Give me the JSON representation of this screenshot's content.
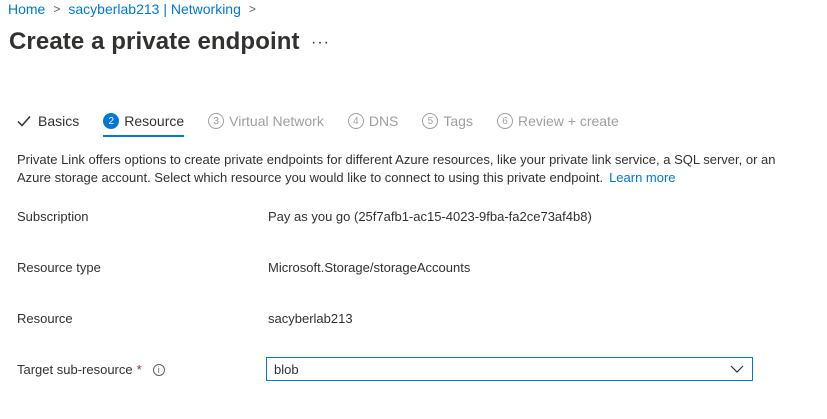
{
  "breadcrumb": {
    "items": [
      "Home",
      "sacyberlab213 | Networking"
    ]
  },
  "page": {
    "title": "Create a private endpoint",
    "more": "···"
  },
  "tabs": [
    {
      "number": "",
      "label": "Basics",
      "state": "done"
    },
    {
      "number": "2",
      "label": "Resource",
      "state": "active"
    },
    {
      "number": "3",
      "label": "Virtual Network",
      "state": "disabled"
    },
    {
      "number": "4",
      "label": "DNS",
      "state": "disabled"
    },
    {
      "number": "5",
      "label": "Tags",
      "state": "disabled"
    },
    {
      "number": "6",
      "label": "Review + create",
      "state": "disabled"
    }
  ],
  "description": {
    "text": "Private Link offers options to create private endpoints for different Azure resources, like your private link service, a SQL server, or an Azure storage account. Select which resource you would like to connect to using this private endpoint.",
    "link": "Learn more"
  },
  "fields": {
    "subscription": {
      "label": "Subscription",
      "value": "Pay as you go (25f7afb1-ac15-4023-9fba-fa2ce73af4b8)"
    },
    "resource_type": {
      "label": "Resource type",
      "value": "Microsoft.Storage/storageAccounts"
    },
    "resource": {
      "label": "Resource",
      "value": "sacyberlab213"
    },
    "target_sub_resource": {
      "label": "Target sub-resource",
      "required_mark": "*",
      "info_icon": "i",
      "value": "blob"
    }
  },
  "colors": {
    "accent": "#0078d4",
    "text": "#323130",
    "disabled": "#a19f9d",
    "required": "#a4262c"
  }
}
